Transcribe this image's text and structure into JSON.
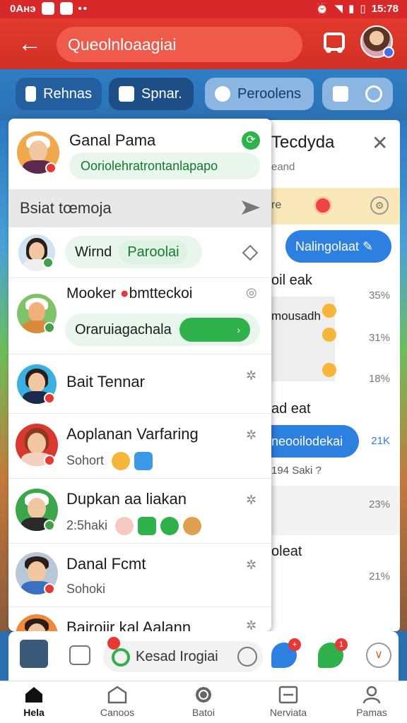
{
  "status_bar": {
    "left_text": "0Анэ",
    "time": "15:78"
  },
  "app_bar": {
    "search_text": "Queolnloaagiai"
  },
  "chips": [
    {
      "label": "Rehnas"
    },
    {
      "label": "Spnar."
    },
    {
      "label": "Peroolens"
    }
  ],
  "left_panel": {
    "header": {
      "name": "Ganal Pama",
      "subtitle": "Ooriolehratrontanlapapo"
    },
    "section_title": "Bsiat tœmoja",
    "rows": [
      {
        "name": "Wirnd",
        "tag": "Paroolai"
      },
      {
        "name": "Mooker",
        "name_suffix": "bmtteckoi",
        "bar_text": "Oraruiagachala"
      },
      {
        "name": "Bait Tennar"
      },
      {
        "name": "Aoplanan Varfaring",
        "sub": "Sohort"
      },
      {
        "name": "Dupkan aa liakan",
        "sub": "2:5haki"
      },
      {
        "name": "Danal Fcmt",
        "sub": "Sohoki"
      },
      {
        "name": "Bairoiir kal Aalann"
      }
    ]
  },
  "right_panel": {
    "title": "Tecdyda",
    "subtitle": "eand",
    "banner_text": "re",
    "blue_button": "Nalingolaat",
    "items": [
      {
        "text": "oil eak",
        "pct": "35%"
      },
      {
        "text": "mousadh",
        "pct": "31%"
      },
      {
        "text": "",
        "pct": "18%"
      },
      {
        "text": "ad eat",
        "pct": ""
      },
      {
        "text": "neooilodekai",
        "pct": "21K"
      },
      {
        "text": "194 Saki ?",
        "pct": ""
      },
      {
        "text": "",
        "pct": "23%"
      },
      {
        "text": "oleat",
        "pct": ""
      },
      {
        "text": "",
        "pct": "21%"
      }
    ]
  },
  "input_bar": {
    "placeholder": "Kesad Irogiai",
    "badge1": "+",
    "badge2": "1"
  },
  "bottom_nav": [
    {
      "label": "Hela"
    },
    {
      "label": "Canoos"
    },
    {
      "label": "Batoi"
    },
    {
      "label": "Nerviata"
    },
    {
      "label": "Pamas"
    }
  ]
}
